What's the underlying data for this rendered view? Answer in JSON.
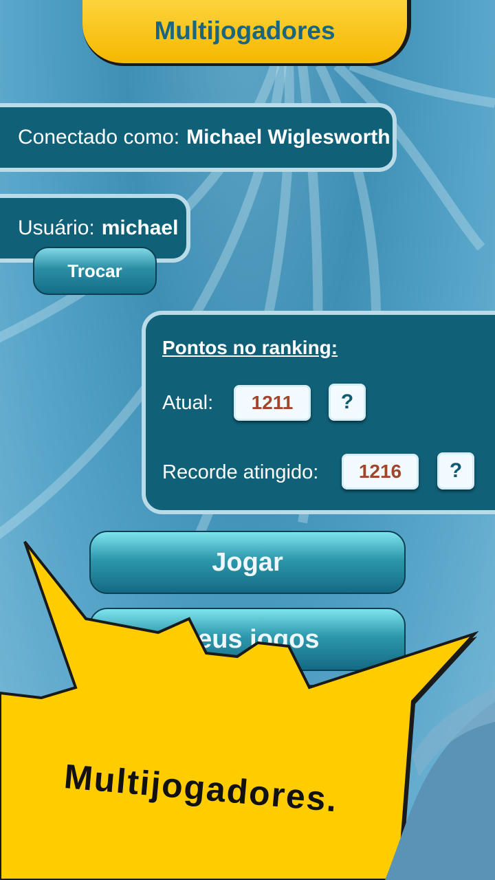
{
  "header": {
    "title": "Multijogadores"
  },
  "connection": {
    "label": "Conectado como:",
    "name": "Michael Wiglesworth"
  },
  "user": {
    "label": "Usuário:",
    "name": "michael",
    "switch_label": "Trocar"
  },
  "ranking": {
    "title": "Pontos no ranking:",
    "current_label": "Atual:",
    "current_value": "1211",
    "record_label": "Recorde atingido:",
    "record_value": "1216",
    "help_label": "?"
  },
  "buttons": {
    "play": "Jogar",
    "my_games": "Meus jogos"
  },
  "callout": {
    "text": "Multijogadores."
  },
  "colors": {
    "accent_yellow": "#ffcc00",
    "panel": "#106078",
    "score_text": "#a0462a"
  }
}
